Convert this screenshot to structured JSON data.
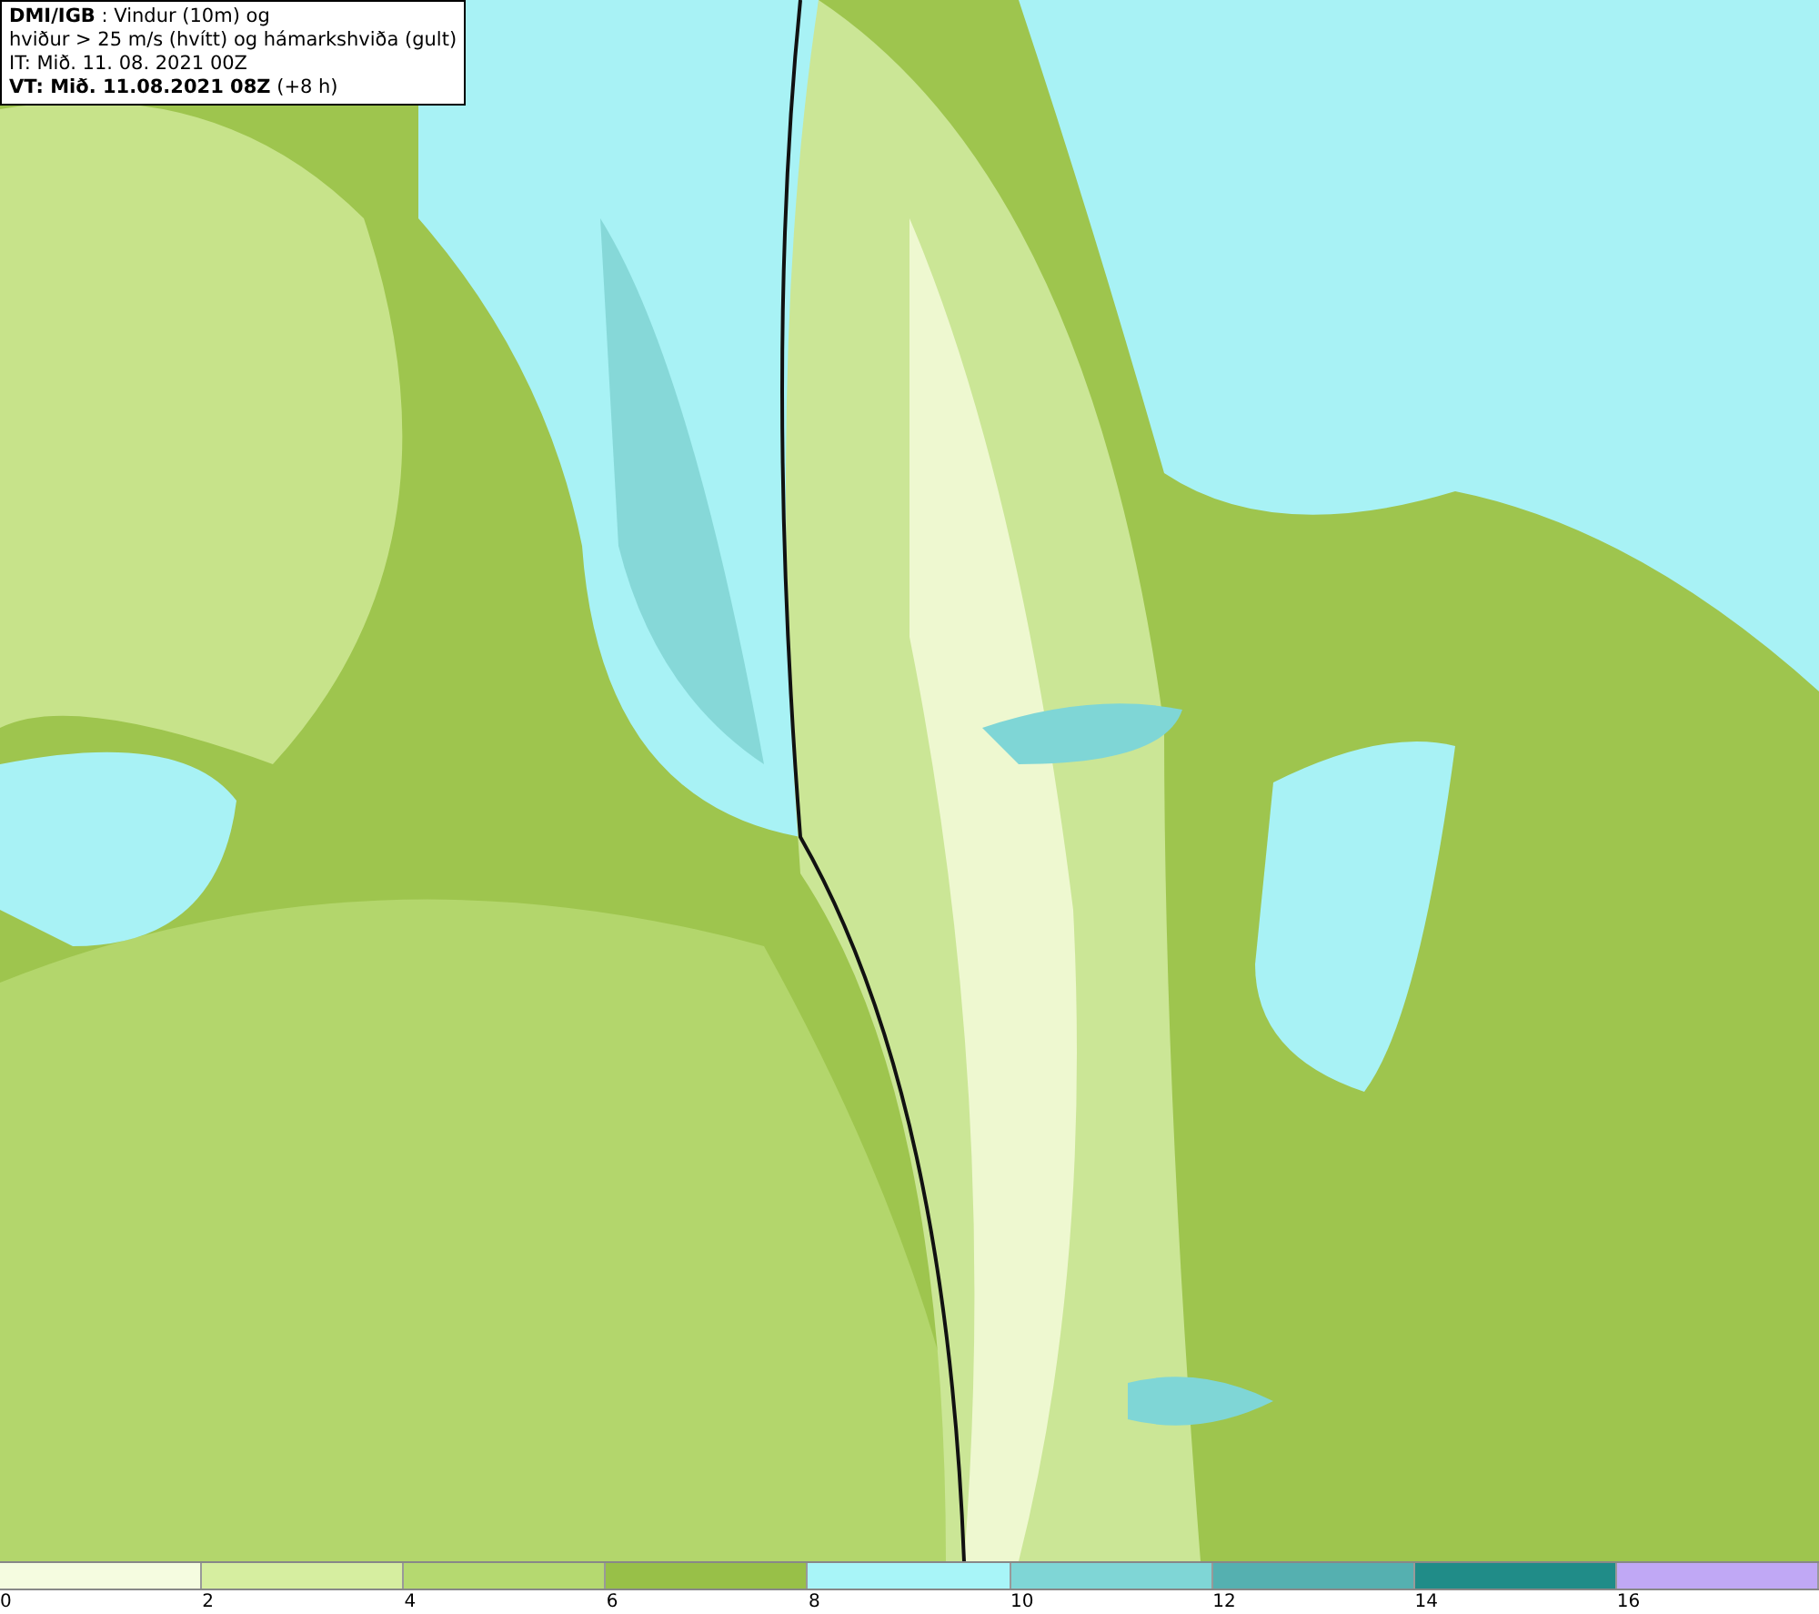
{
  "header": {
    "lines": [
      "**DMI/IGB** : Vindur (10m) og",
      "hviður > 25 m/s (hvítt) og hámarkshviða (gult)",
      "IT: Mið. 11. 08. 2021 00Z",
      "**VT: Mið. 11.08.2021 08Z** (+8 h)"
    ]
  },
  "legend": [
    {
      "label": "0",
      "color": "#f5fce0"
    },
    {
      "label": "2",
      "color": "#d6eea0"
    },
    {
      "label": "4",
      "color": "#b5d970"
    },
    {
      "label": "6",
      "color": "#98c048"
    },
    {
      "label": "8",
      "color": "#a8f5f8"
    },
    {
      "label": "10",
      "color": "#7fd6d6"
    },
    {
      "label": "12",
      "color": "#55b0b0"
    },
    {
      "label": "14",
      "color": "#208c88"
    },
    {
      "label": "16",
      "color": "#c0a8f5"
    }
  ]
}
